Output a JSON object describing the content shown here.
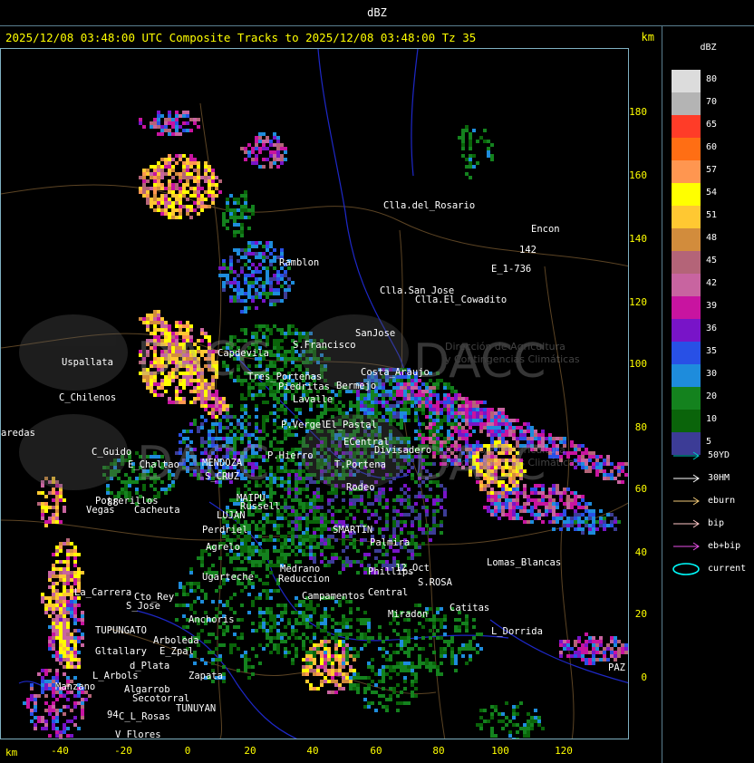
{
  "window_title": "dBZ",
  "header": {
    "title": "2025/12/08 03:48:00 UTC Composite Tracks to 2025/12/08 03:48:00 Tz 35",
    "unit_right": "km"
  },
  "axes": {
    "x_label": "km",
    "x_ticks": [
      "-40",
      "-20",
      "0",
      "20",
      "40",
      "60",
      "80",
      "100",
      "120"
    ],
    "y_ticks": [
      "180",
      "160",
      "140",
      "120",
      "100",
      "80",
      "60",
      "40",
      "20",
      "0"
    ]
  },
  "legend": {
    "unit": "dBZ",
    "levels": [
      {
        "label": "80",
        "color": "#dcdcdc"
      },
      {
        "label": "70",
        "color": "#b4b4b4"
      },
      {
        "label": "65",
        "color": "#ff3c28"
      },
      {
        "label": "60",
        "color": "#ff6e14"
      },
      {
        "label": "57",
        "color": "#ff9650"
      },
      {
        "label": "54",
        "color": "#ffff00"
      },
      {
        "label": "51",
        "color": "#ffc832"
      },
      {
        "label": "48",
        "color": "#d28c3c"
      },
      {
        "label": "45",
        "color": "#b46478"
      },
      {
        "label": "42",
        "color": "#c864a0"
      },
      {
        "label": "39",
        "color": "#c814a0"
      },
      {
        "label": "36",
        "color": "#7814c8"
      },
      {
        "label": "35",
        "color": "#2850e6"
      },
      {
        "label": "30",
        "color": "#1e8cdc"
      },
      {
        "label": "20",
        "color": "#14821e"
      },
      {
        "label": "10",
        "color": "#0a640a"
      },
      {
        "label": "5",
        "color": "#3c3c96"
      }
    ],
    "tracks": [
      {
        "label": "50YD",
        "color": "#00c8c8"
      },
      {
        "label": "30HM",
        "color": "#ffffff"
      },
      {
        "label": "eburn",
        "color": "#f0c878"
      },
      {
        "label": "bip",
        "color": "#ffc8c8"
      },
      {
        "label": "eb+bip",
        "color": "#e650e6"
      },
      {
        "label": "current",
        "color": "#00ffff"
      }
    ]
  },
  "map_labels": [
    {
      "text": "Clla.del_Rosario"
    },
    {
      "text": "Encon"
    },
    {
      "text": "E_1-736"
    },
    {
      "text": "142"
    },
    {
      "text": "Ramblon"
    },
    {
      "text": "Clla.San_Jose"
    },
    {
      "text": "Clla.El_Cowadito"
    },
    {
      "text": "Uspallata"
    },
    {
      "text": "Capdevila"
    },
    {
      "text": "S.Francisco"
    },
    {
      "text": "SanJose"
    },
    {
      "text": "C_Chilenos"
    },
    {
      "text": "Lavalle"
    },
    {
      "text": "Costa_Araujo"
    },
    {
      "text": "Piedritas"
    },
    {
      "text": "Bermejo"
    },
    {
      "text": "P.Vergel"
    },
    {
      "text": "El_Pastal"
    },
    {
      "text": "C_Guido"
    },
    {
      "text": "E_Chaltao"
    },
    {
      "text": "MENDOZA"
    },
    {
      "text": "P.Hierro"
    },
    {
      "text": "ECentral"
    },
    {
      "text": "Divisadero"
    },
    {
      "text": "S_CRUZ"
    },
    {
      "text": "T.Portena"
    },
    {
      "text": "Potrerillos"
    },
    {
      "text": "Vegas"
    },
    {
      "text": "Cacheuta"
    },
    {
      "text": "Tres_Porteñas"
    },
    {
      "text": "Rodeo"
    },
    {
      "text": "MAIPU"
    },
    {
      "text": "Russell"
    },
    {
      "text": "LUJAN"
    },
    {
      "text": "Perdriel"
    },
    {
      "text": "SMARTIN"
    },
    {
      "text": "Palmira"
    },
    {
      "text": "Agrelo"
    },
    {
      "text": "Medrano"
    },
    {
      "text": "Ugarteche"
    },
    {
      "text": "Reduccion"
    },
    {
      "text": "Phillips"
    },
    {
      "text": "12_Oct"
    },
    {
      "text": "S.ROSA"
    },
    {
      "text": "Lomas_Blancas"
    },
    {
      "text": "La_Carrera"
    },
    {
      "text": "Cto_Rey"
    },
    {
      "text": "S_Jose"
    },
    {
      "text": "Campamentos"
    },
    {
      "text": "Central"
    },
    {
      "text": "Catitas"
    },
    {
      "text": "TUPUNGATO"
    },
    {
      "text": "Anchoris"
    },
    {
      "text": "Miradon"
    },
    {
      "text": "L_Dorrida"
    },
    {
      "text": "Arboleda"
    },
    {
      "text": "E_Zpal"
    },
    {
      "text": "Gltallary"
    },
    {
      "text": "d_Plata"
    },
    {
      "text": "L_Arbols"
    },
    {
      "text": "Zapata"
    },
    {
      "text": "Algarrob"
    },
    {
      "text": "Manzano"
    },
    {
      "text": "Secotorral"
    },
    {
      "text": "TUNUYAN"
    },
    {
      "text": "C_L_Rosas"
    },
    {
      "text": "V_Flores"
    },
    {
      "text": "aredas"
    },
    {
      "text": "PAZ"
    },
    {
      "text": "88"
    },
    {
      "text": "94"
    }
  ],
  "watermark": {
    "org": "DACC",
    "subtitle1": "Dirección de Agricultura",
    "subtitle2": "y Contingencias Climáticas"
  }
}
